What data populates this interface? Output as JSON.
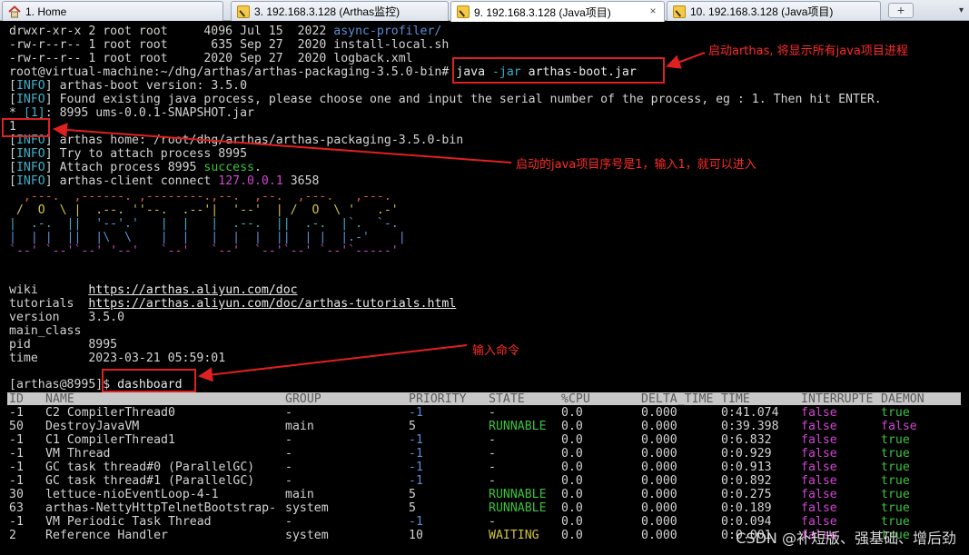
{
  "tabs": [
    {
      "label": "1. Home",
      "icon": "home-icon"
    },
    {
      "label": "3. 192.168.3.128 (Arthas监控)",
      "icon": "wrench-icon"
    },
    {
      "label": "9. 192.168.3.128 (Java项目)",
      "icon": "wrench-icon"
    },
    {
      "label": "10. 192.168.3.128 (Java项目)",
      "icon": "wrench-icon"
    }
  ],
  "tab_close": "×",
  "new_tab": "+",
  "terminal": {
    "ls1_perm": "drwxr-xr-x 2 root root     4096 Jul 15  2022 ",
    "ls1_name": "async-profiler/",
    "ls2": "-rw-r--r-- 1 root root      635 Sep 27  2020 install-local.sh",
    "ls3": "-rw-r--r-- 1 root root     2020 Sep 27  2020 logback.xml",
    "prompt": "root@virtual-machine:~/dhg/arthas/arthas-packaging-3.5.0-bin# ",
    "cmd_java": "java ",
    "cmd_flag": "-jar",
    "cmd_rest": " arthas-boot.jar",
    "info_tag": "INFO",
    "info1": " arthas-boot version: 3.5.0",
    "info2": " Found existing java process, please choose one and input the serial number of the process, eg : 1. Then hit ENTER.",
    "proc_star": "* ",
    "proc_idx": "[1]",
    "proc_rest": ": 8995 ums-0.0.1-SNAPSHOT.jar",
    "input_1": "1",
    "info3": " arthas home: /root/dhg/arthas/arthas-packaging-3.5.0-bin",
    "info4": " Try to attach process 8995",
    "info5_a": " Attach process 8995 ",
    "info5_b": "success",
    "info5_c": ".",
    "info6_a": " arthas-client connect ",
    "info6_b": "127.0.0.1",
    "info6_c": " 3658",
    "logo": [
      "  ,---.  ,------. ,--------.,--.  ,--.  ,---.   ,---.",
      " /  O  \\ |  .--. ''--.  .--'|  '--'  | /  O  \\ '   .-'",
      "|  .-.  ||  '--'.'   |  |   |  .--.  ||  .-.  |`.  `-.",
      "|  | |  ||  |\\  \\    |  |   |  |  |  ||  | |  |.-'    |",
      "`--' `--'`--' '--'   `--'   `--'  `--'`--' `--'`-----'"
    ],
    "wiki_label": "wiki       ",
    "wiki_url": "https://arthas.aliyun.com/doc",
    "tutorials_label": "tutorials  ",
    "tutorials_url": "https://arthas.aliyun.com/doc/arthas-tutorials.html",
    "version_line": "version    3.5.0",
    "main_class_line": "main_class",
    "pid_line": "pid        8995",
    "time_line": "time       2023-03-21 05:59:01",
    "arthas_prompt": "[arthas@8995]$ ",
    "dashboard_cmd": "dashboard"
  },
  "dashboard": {
    "headers": [
      "ID",
      "NAME",
      "GROUP",
      "PRIORITY",
      "STATE",
      "%CPU",
      "DELTA_TIME",
      "TIME",
      "INTERRUPTE",
      "DAEMON"
    ],
    "rows": [
      [
        "-1",
        "C2 CompilerThread0",
        "-",
        "-1",
        "-",
        "0.0",
        "0.000",
        "0:41.074",
        "false",
        "true"
      ],
      [
        "50",
        "DestroyJavaVM",
        "main",
        "5",
        "RUNNABLE",
        "0.0",
        "0.000",
        "0:39.398",
        "false",
        "false"
      ],
      [
        "-1",
        "C1 CompilerThread1",
        "-",
        "-1",
        "-",
        "0.0",
        "0.000",
        "0:6.832",
        "false",
        "true"
      ],
      [
        "-1",
        "VM Thread",
        "-",
        "-1",
        "-",
        "0.0",
        "0.000",
        "0:0.929",
        "false",
        "true"
      ],
      [
        "-1",
        "GC task thread#0 (ParallelGC)",
        "-",
        "-1",
        "-",
        "0.0",
        "0.000",
        "0:0.913",
        "false",
        "true"
      ],
      [
        "-1",
        "GC task thread#1 (ParallelGC)",
        "-",
        "-1",
        "-",
        "0.0",
        "0.000",
        "0:0.892",
        "false",
        "true"
      ],
      [
        "30",
        "lettuce-nioEventLoop-4-1",
        "main",
        "5",
        "RUNNABLE",
        "0.0",
        "0.000",
        "0:0.275",
        "false",
        "true"
      ],
      [
        "63",
        "arthas-NettyHttpTelnetBootstrap-",
        "system",
        "5",
        "RUNNABLE",
        "0.0",
        "0.000",
        "0:0.189",
        "false",
        "true"
      ],
      [
        "-1",
        "VM Periodic Task Thread",
        "-",
        "-1",
        "-",
        "0.0",
        "0.000",
        "0:0.094",
        "false",
        "true"
      ],
      [
        "2",
        "Reference Handler",
        "system",
        "10",
        "WAITING",
        "0.0",
        "0.000",
        "0:0.001",
        "false",
        "true"
      ]
    ]
  },
  "annotations": {
    "start": "启动arthas, 将显示所有java项目进程",
    "serial": "启动的java项目序号是1，输入1，就可以进入",
    "command": "输入命令"
  },
  "watermark": "CSDN @补短版、强基础、增后劲",
  "colors": {
    "annotation": "#e02020",
    "info": "#3ab0c8",
    "success": "#3cc23c",
    "runnable": "#3cc23c",
    "false": "#d245d2",
    "true": "#3cc23c",
    "waiting": "#d3c43c"
  }
}
